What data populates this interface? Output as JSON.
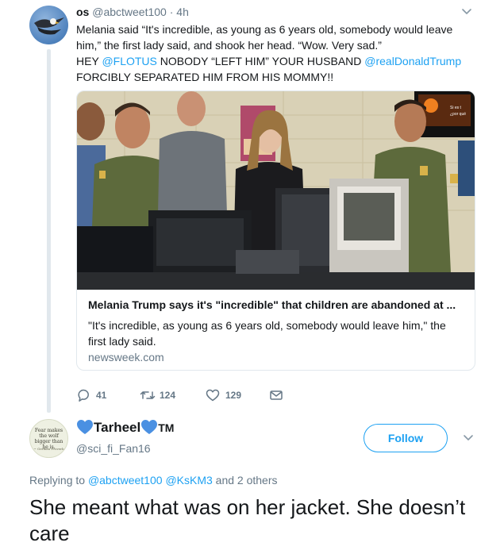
{
  "tweet": {
    "display_name": "os",
    "handle": "@abctweet100",
    "separator": " · ",
    "time": "4h",
    "text_line1": "Melania said “It's incredible, as young as 6 years old, somebody would leave him,” the first lady said, and shook her head. “Wow. Very sad.”",
    "text_l2_a": "HEY ",
    "text_l2_mention1": "@FLOTUS",
    "text_l2_b": " NOBODY “LEFT HIM” YOUR HUSBAND ",
    "text_l2_mention2": "@realDonaldTrump",
    "text_l3": "FORCIBLY SEPARATED HIM FROM HIS MOMMY!!",
    "card": {
      "title": "Melania Trump says it's \"incredible\" that children are abandoned at ...",
      "description": "\"It's incredible, as young as 6 years old, somebody would leave him,\" the first lady said.",
      "domain": "newsweek.com",
      "screen_text_line1": "Si es t",
      "screen_text_line2": "¿por qué"
    },
    "actions": {
      "replies": "41",
      "retweets": "124",
      "likes": "129"
    }
  },
  "reply": {
    "display_name_text": "Tarheel",
    "display_name_suffix": "TM",
    "handle": "@sci_fi_Fan16",
    "follow_label": "Follow",
    "avatar_quote": "Fear makes the wolf bigger than he is.",
    "avatar_quote_author": "~ German Proverb",
    "replying_prefix": "Replying to ",
    "replying_to_1": "@abctweet100",
    "replying_to_2": "@KsKM3",
    "replying_suffix": " and 2 others",
    "text": "She meant what was on her jacket. She doesn’t care"
  },
  "colors": {
    "accent_blue": "#1da1f2",
    "secondary_text": "#657786",
    "border": "#e1e8ed",
    "heart_blue": "#4a90e2",
    "uniform_green": "#5d6a3c"
  },
  "icons": {
    "reply": "reply-icon",
    "retweet": "retweet-icon",
    "like": "heart-icon",
    "dm": "envelope-icon",
    "caret": "chevron-down-icon"
  }
}
